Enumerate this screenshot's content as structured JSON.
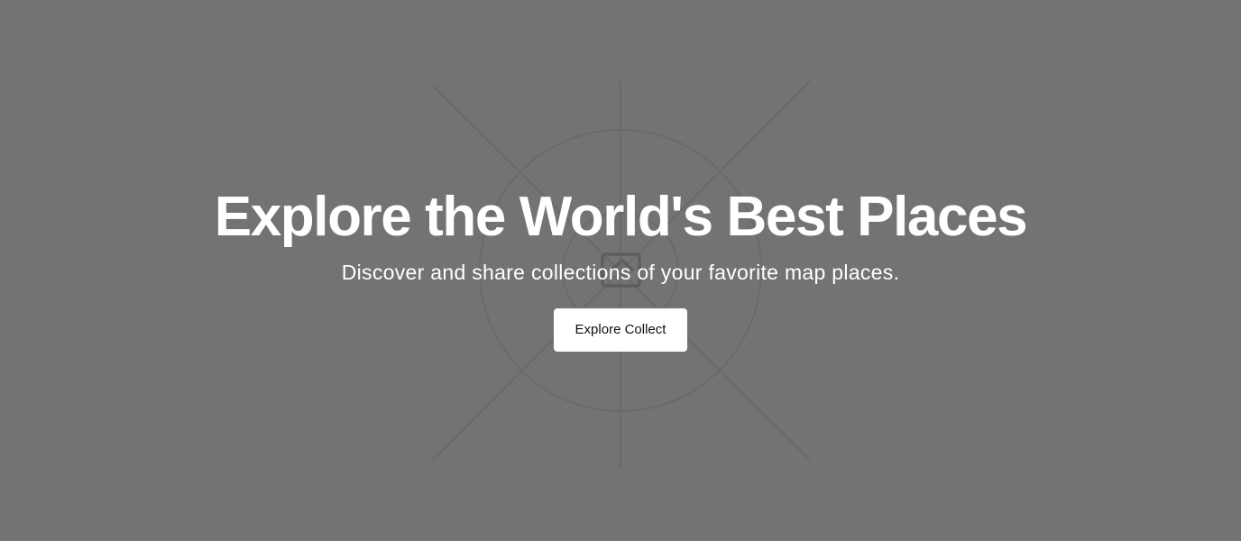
{
  "hero": {
    "title": "Explore the World's Best Places",
    "subtitle": "Discover and share collections of your favorite map places.",
    "cta_label": "Explore Collect",
    "background_image_icon": "image-placeholder-icon"
  },
  "colors": {
    "background": "#737373",
    "decoration_lines": "#6a6a6a",
    "text": "#ffffff",
    "button_background": "#ffffff",
    "button_text": "#111111"
  }
}
